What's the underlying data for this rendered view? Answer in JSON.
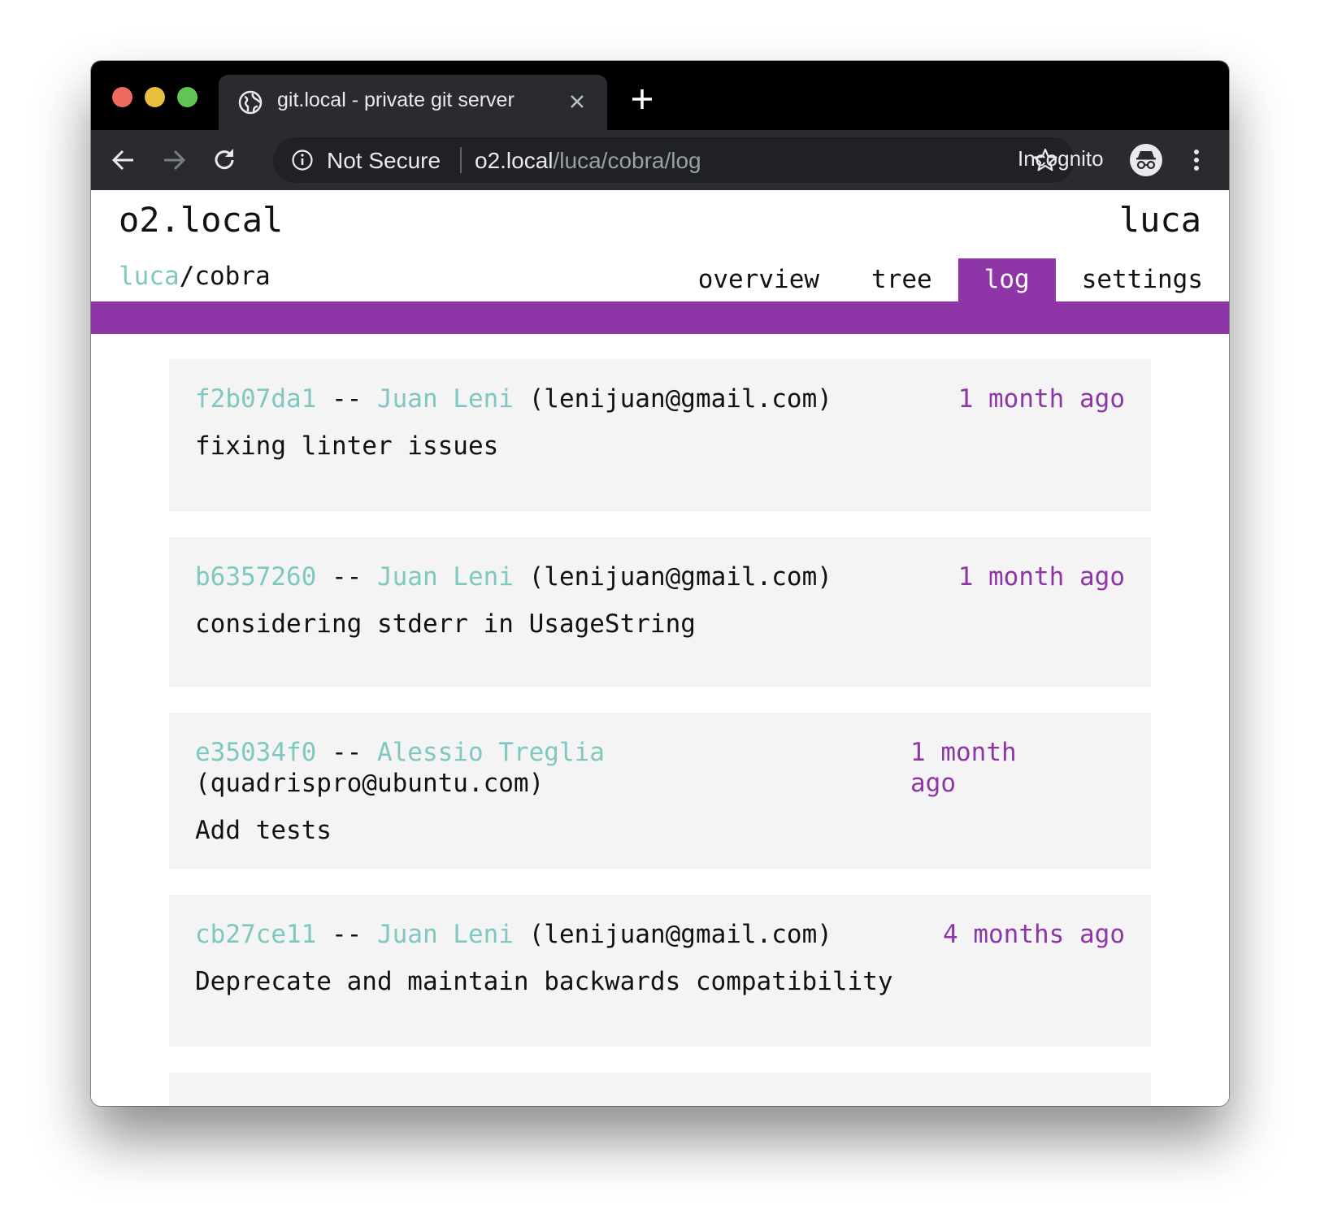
{
  "browser": {
    "tab_title": "git.local - private git server",
    "security_label": "Not Secure",
    "url_host": "o2.local",
    "url_path": "/luca/cobra/log",
    "incognito_label": "Incognito"
  },
  "header": {
    "site_title": "o2.local",
    "user": "luca"
  },
  "breadcrumb": {
    "owner": "luca",
    "separator": "/",
    "repo": "cobra"
  },
  "nav": {
    "items": [
      "overview",
      "tree",
      "log",
      "settings"
    ],
    "active": "log"
  },
  "commits": [
    {
      "hash": "f2b07da1",
      "separator": "--",
      "author": "Juan Leni",
      "email": "(lenijuan@gmail.com)",
      "time": "1 month ago",
      "message": "fixing linter issues"
    },
    {
      "hash": "b6357260",
      "separator": "--",
      "author": "Juan Leni",
      "email": "(lenijuan@gmail.com)",
      "time": "1 month ago",
      "message": "considering stderr in UsageString"
    },
    {
      "hash": "e35034f0",
      "separator": "--",
      "author": "Alessio Treglia",
      "email": "(quadrispro@ubuntu.com)",
      "time": "1 month ago",
      "message": "Add tests"
    },
    {
      "hash": "cb27ce11",
      "separator": "--",
      "author": "Juan Leni",
      "email": "(lenijuan@gmail.com)",
      "time": "4 months ago",
      "message": "Deprecate and maintain backwards compatibility"
    }
  ],
  "colors": {
    "accent": "#8e35a8",
    "link": "#7fc8c0",
    "card_bg": "#f4f4f4"
  }
}
